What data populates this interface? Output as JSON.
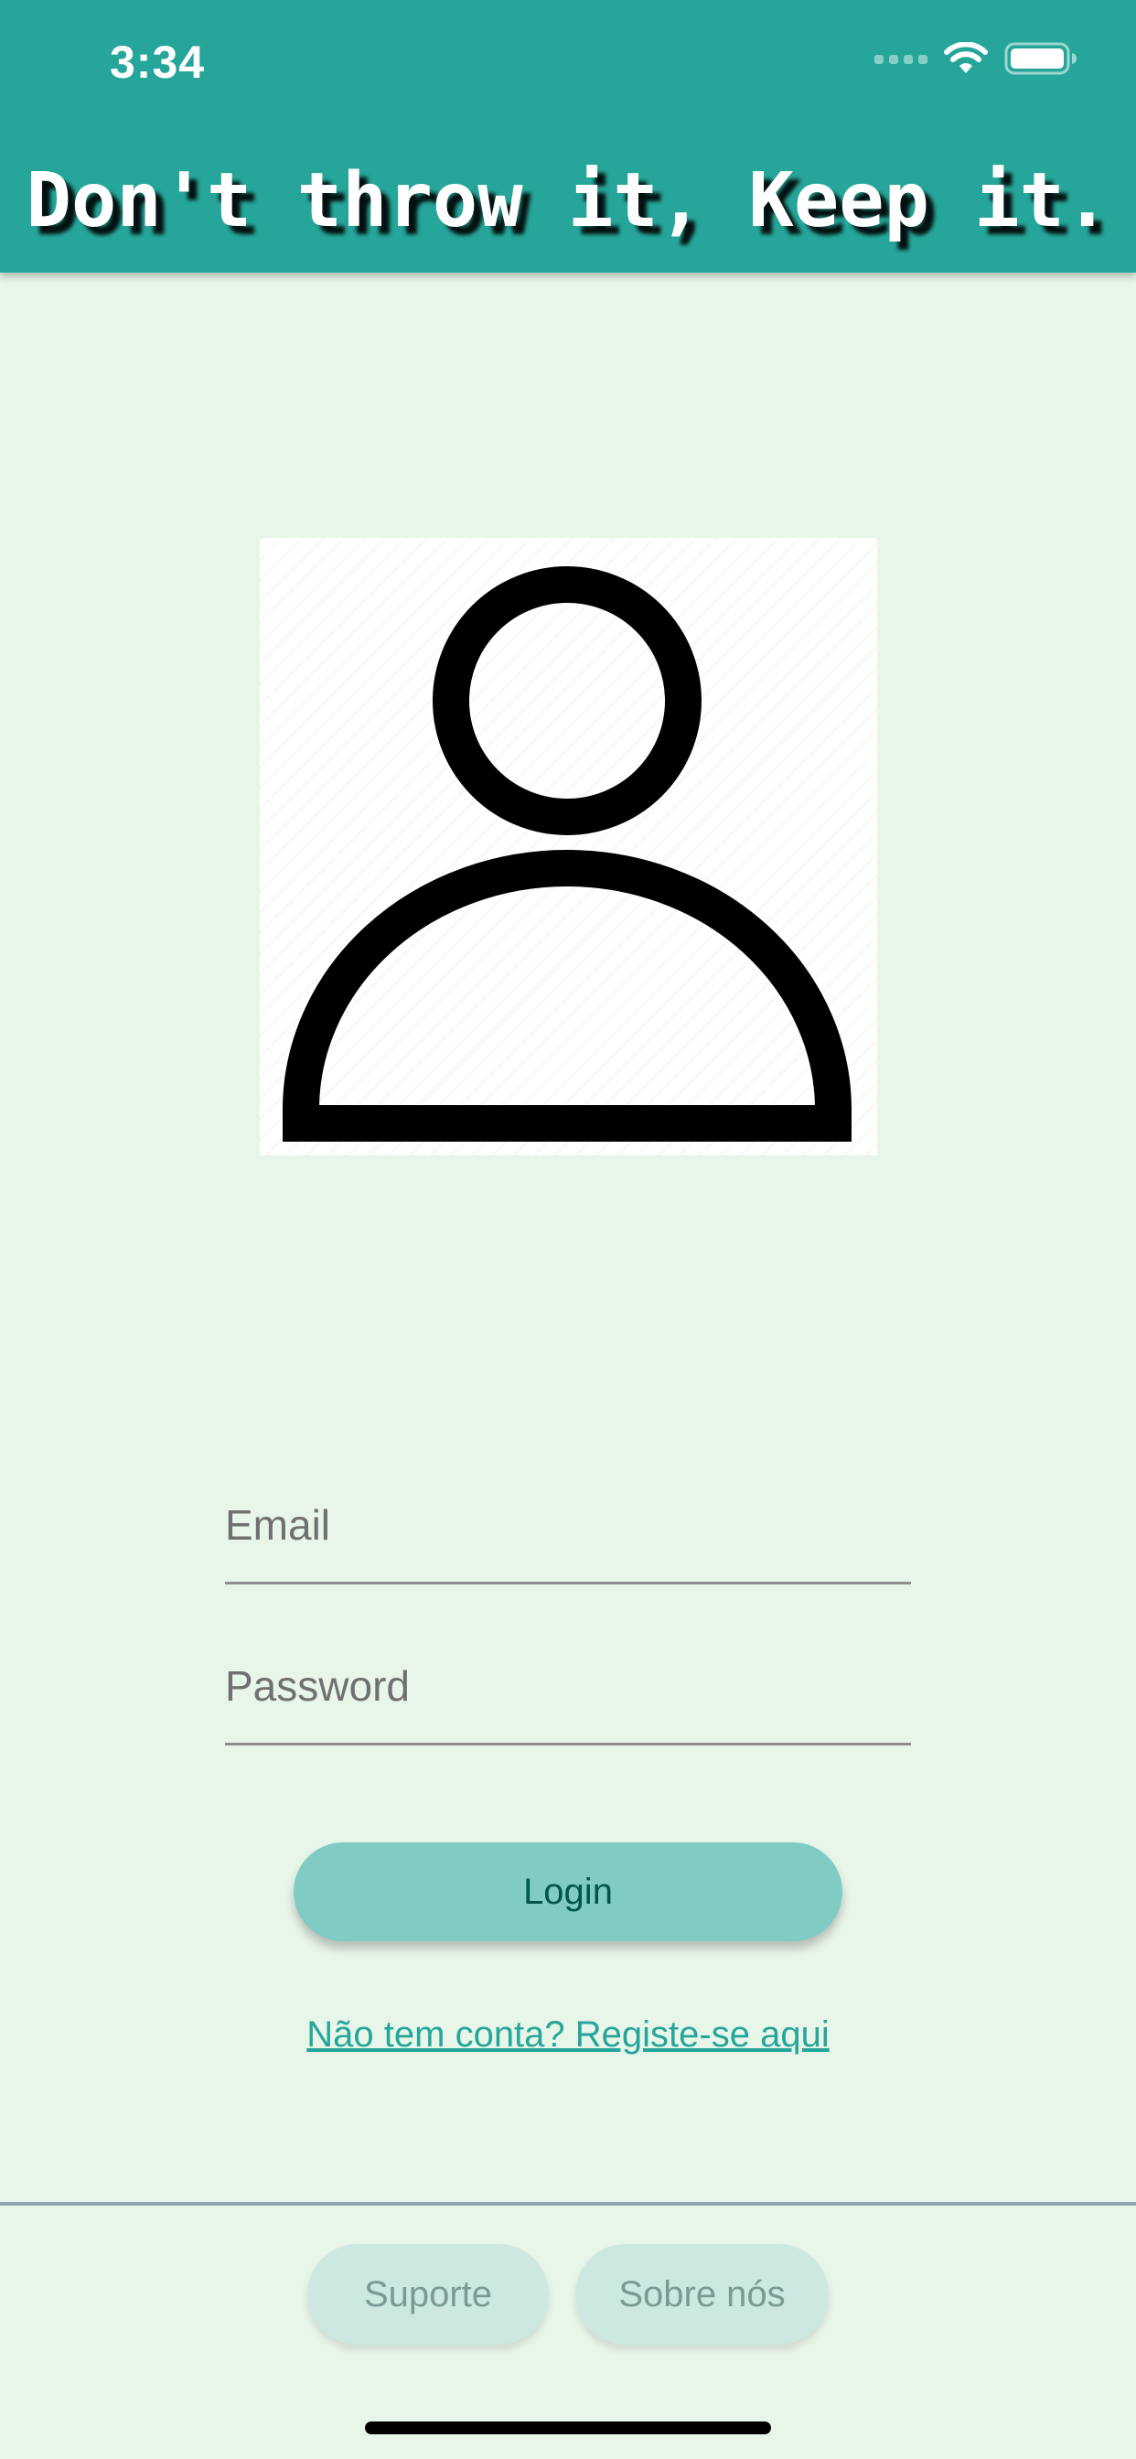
{
  "status_bar": {
    "time": "3:34",
    "icons": [
      "cellular-signal-icon",
      "wifi-icon",
      "battery-icon"
    ]
  },
  "header": {
    "title": "Don't throw it, Keep it."
  },
  "avatar": {
    "icon": "user-icon"
  },
  "form": {
    "email": {
      "value": "",
      "placeholder": "Email"
    },
    "password": {
      "value": "",
      "placeholder": "Password"
    },
    "login_label": "Login",
    "register_link": "Não tem conta? Registe-se aqui"
  },
  "footer": {
    "support_label": "Suporte",
    "about_label": "Sobre nós"
  },
  "colors": {
    "primary": "#26a69a",
    "background": "#e8f5e9",
    "button": "#80cbc4",
    "button_text": "#00574b",
    "footer_button": "#cde7e1"
  }
}
